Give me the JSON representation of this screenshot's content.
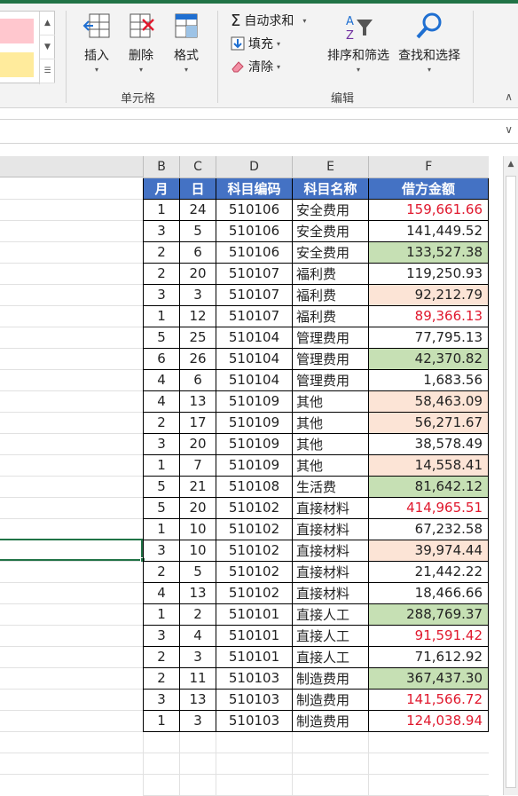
{
  "ribbon": {
    "gallery_scroll": [
      "▲",
      "▼",
      "☰"
    ],
    "cells_group": {
      "label": "单元格",
      "insert": "插入",
      "delete": "删除",
      "format": "格式"
    },
    "editing_group": {
      "label": "编辑",
      "autosum": "自动求和",
      "fill": "填充",
      "clear": "清除",
      "sort_filter": "排序和筛选",
      "find_select": "查找和选择"
    },
    "dropdown_glyph": "▾",
    "collapse_glyph": "∧"
  },
  "formula_bar": {
    "expand_glyph": "∨"
  },
  "sheet": {
    "col_letters": [
      "B",
      "C",
      "D",
      "E",
      "F"
    ],
    "headers": [
      "月",
      "日",
      "科目编码",
      "科目名称",
      "借方金额"
    ],
    "rows": [
      {
        "m": "1",
        "d": "24",
        "code": "510106",
        "name": "安全费用",
        "amt": "159,661.66",
        "red": true,
        "fill": ""
      },
      {
        "m": "3",
        "d": "5",
        "code": "510106",
        "name": "安全费用",
        "amt": "141,449.52",
        "red": false,
        "fill": ""
      },
      {
        "m": "2",
        "d": "6",
        "code": "510106",
        "name": "安全费用",
        "amt": "133,527.38",
        "red": false,
        "fill": "green"
      },
      {
        "m": "2",
        "d": "20",
        "code": "510107",
        "name": "福利费",
        "amt": "119,250.93",
        "red": false,
        "fill": ""
      },
      {
        "m": "3",
        "d": "3",
        "code": "510107",
        "name": "福利费",
        "amt": "92,212.79",
        "red": false,
        "fill": "peach"
      },
      {
        "m": "1",
        "d": "12",
        "code": "510107",
        "name": "福利费",
        "amt": "89,366.13",
        "red": true,
        "fill": ""
      },
      {
        "m": "5",
        "d": "25",
        "code": "510104",
        "name": "管理费用",
        "amt": "77,795.13",
        "red": false,
        "fill": ""
      },
      {
        "m": "6",
        "d": "26",
        "code": "510104",
        "name": "管理费用",
        "amt": "42,370.82",
        "red": false,
        "fill": "green"
      },
      {
        "m": "4",
        "d": "6",
        "code": "510104",
        "name": "管理费用",
        "amt": "1,683.56",
        "red": false,
        "fill": ""
      },
      {
        "m": "4",
        "d": "13",
        "code": "510109",
        "name": "其他",
        "amt": "58,463.09",
        "red": false,
        "fill": "peach"
      },
      {
        "m": "2",
        "d": "17",
        "code": "510109",
        "name": "其他",
        "amt": "56,271.67",
        "red": false,
        "fill": "peach"
      },
      {
        "m": "3",
        "d": "20",
        "code": "510109",
        "name": "其他",
        "amt": "38,578.49",
        "red": false,
        "fill": ""
      },
      {
        "m": "1",
        "d": "7",
        "code": "510109",
        "name": "其他",
        "amt": "14,558.41",
        "red": false,
        "fill": "peach"
      },
      {
        "m": "5",
        "d": "21",
        "code": "510108",
        "name": "生活费",
        "amt": "81,642.12",
        "red": false,
        "fill": "green"
      },
      {
        "m": "5",
        "d": "20",
        "code": "510102",
        "name": "直接材料",
        "amt": "414,965.51",
        "red": true,
        "fill": ""
      },
      {
        "m": "1",
        "d": "10",
        "code": "510102",
        "name": "直接材料",
        "amt": "67,232.58",
        "red": false,
        "fill": ""
      },
      {
        "m": "3",
        "d": "10",
        "code": "510102",
        "name": "直接材料",
        "amt": "39,974.44",
        "red": false,
        "fill": "peach"
      },
      {
        "m": "2",
        "d": "5",
        "code": "510102",
        "name": "直接材料",
        "amt": "21,442.22",
        "red": false,
        "fill": ""
      },
      {
        "m": "4",
        "d": "13",
        "code": "510102",
        "name": "直接材料",
        "amt": "18,466.66",
        "red": false,
        "fill": ""
      },
      {
        "m": "1",
        "d": "2",
        "code": "510101",
        "name": "直接人工",
        "amt": "288,769.37",
        "red": false,
        "fill": "green"
      },
      {
        "m": "3",
        "d": "4",
        "code": "510101",
        "name": "直接人工",
        "amt": "91,591.42",
        "red": true,
        "fill": ""
      },
      {
        "m": "2",
        "d": "3",
        "code": "510101",
        "name": "直接人工",
        "amt": "71,612.92",
        "red": false,
        "fill": ""
      },
      {
        "m": "2",
        "d": "11",
        "code": "510103",
        "name": "制造费用",
        "amt": "367,437.30",
        "red": false,
        "fill": "green"
      },
      {
        "m": "3",
        "d": "13",
        "code": "510103",
        "name": "制造费用",
        "amt": "141,566.72",
        "red": true,
        "fill": ""
      },
      {
        "m": "1",
        "d": "3",
        "code": "510103",
        "name": "制造费用",
        "amt": "124,038.94",
        "red": true,
        "fill": ""
      }
    ],
    "empty_rows": 3
  },
  "colors": {
    "accent": "#217346",
    "header_fill": "#4472c4",
    "good_fill": "#c6e0b4",
    "warn_fill": "#fce4d6",
    "red_text": "#e0182d"
  }
}
